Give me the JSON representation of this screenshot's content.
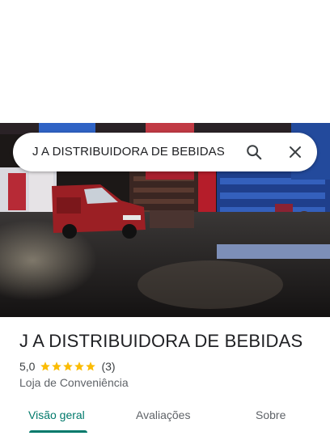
{
  "search": {
    "query": "J A DISTRIBUIDORA DE BEBIDAS",
    "search_icon": "search-icon",
    "clear_icon": "close-icon"
  },
  "place": {
    "title": "J A DISTRIBUIDORA DE BEBIDAS",
    "rating": "5,0",
    "stars": 5,
    "review_count": "(3)",
    "category": "Loja de Conveniência"
  },
  "tabs": [
    {
      "label": "Visão geral",
      "active": true
    },
    {
      "label": "Avaliações",
      "active": false
    },
    {
      "label": "Sobre",
      "active": false
    }
  ],
  "colors": {
    "accent": "#00796b",
    "star": "#fbbc04",
    "text": "#202124",
    "secondary": "#5f6368"
  }
}
